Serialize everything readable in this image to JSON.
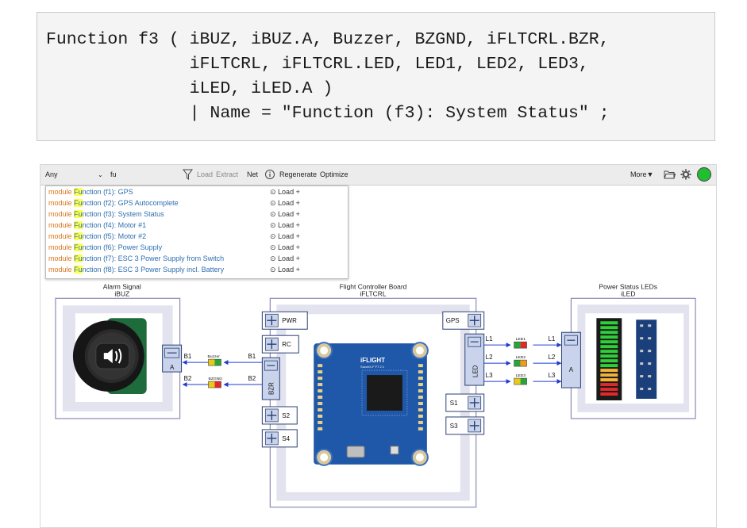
{
  "code": {
    "lines": [
      "Function f3 ( iBUZ, iBUZ.A, Buzzer, BZGND, iFLTCRL.BZR,",
      "              iFLTCRL, iFLTCRL.LED, LED1, LED2, LED3,",
      "              iLED, iLED.A )",
      "              | Name = \"Function (f3): System Status\" ;"
    ]
  },
  "toolbar": {
    "filter_value": "Any",
    "search_value": "fu",
    "load": "Load",
    "extract": "Extract",
    "net": "Net",
    "regenerate": "Regenerate",
    "optimize": "Optimize",
    "more": "More▼"
  },
  "dropdown": {
    "keyword": "module",
    "match": "Fu",
    "action": "Load +",
    "items": [
      {
        "rest": "nction (f1): GPS"
      },
      {
        "rest": "nction (f2): GPS Autocomplete"
      },
      {
        "rest": "nction (f3): System Status"
      },
      {
        "rest": "nction (f4): Motor #1"
      },
      {
        "rest": "nction (f5): Motor #2"
      },
      {
        "rest": "nction (f6): Power Supply"
      },
      {
        "rest": "nction (f7): ESC 3 Power Supply from Switch"
      },
      {
        "rest": "nction (f8): ESC 3 Power Supply incl. Battery"
      }
    ]
  },
  "diagram": {
    "alarm": {
      "title": "Alarm Signal",
      "id": "iBUZ",
      "port": "A"
    },
    "fc": {
      "title": "Flight Controller Board",
      "id": "iFLTCRL",
      "ports": [
        "PWR",
        "RC",
        "BZR",
        "S2",
        "S4",
        "GPS",
        "LED",
        "S1",
        "S3"
      ],
      "board_brand": "iFLIGHT",
      "board_model": "SucceX-F F7 2.1"
    },
    "leds": {
      "title": "Power Status LEDs",
      "id": "iLED",
      "port": "A"
    },
    "pins": {
      "b1": "B1",
      "b2": "B2",
      "l1": "L1",
      "l2": "L2",
      "l3": "L3"
    },
    "wires": {
      "buzzer": "Buzzer",
      "bzgnd": "BZGND",
      "led1": "LED1",
      "led2": "LED2",
      "led3": "LED3"
    }
  },
  "colors": {
    "port_fill": "#c9d4ec",
    "port_border": "#2a3f72",
    "box_border": "#8b8bb8",
    "arrow": "#1f3cd6",
    "status_green": "#1fbf2f"
  }
}
